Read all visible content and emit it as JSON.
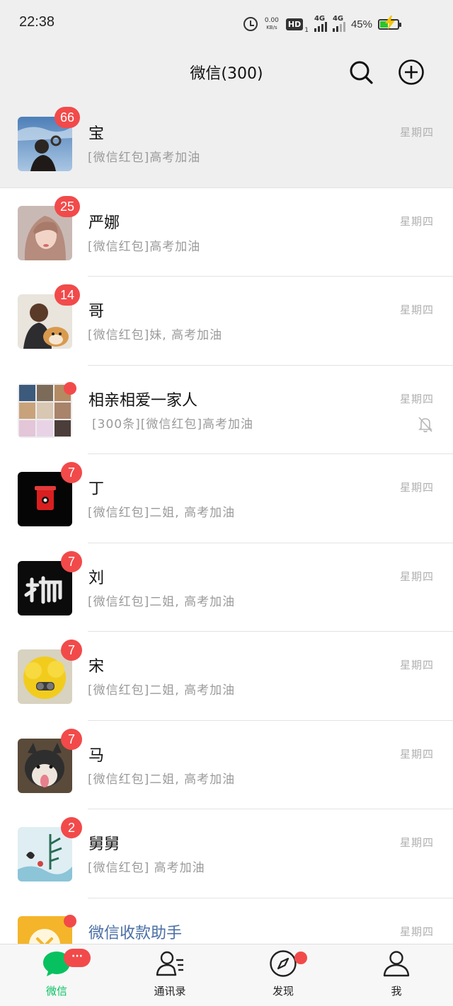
{
  "status_bar": {
    "time": "22:38",
    "net_speed_value": "0.00",
    "net_speed_unit": "KB/s",
    "hd_label": "HD",
    "hd_sub": "1",
    "sim1_net": "4G",
    "sim2_net": "4G",
    "battery_percent": "45%",
    "battery_level": 0.45
  },
  "header": {
    "title": "微信(300)"
  },
  "colors": {
    "badge": "#f24a4a",
    "active_tab": "#07c160",
    "bg_gray": "#efefef",
    "link_blue": "#4a6fa6"
  },
  "chats": [
    {
      "name": "宝",
      "preview": "[微信红包]高考加油",
      "time": "星期四",
      "badge": "66",
      "pinned": true,
      "avatar": "avatar-photo-person-sky"
    },
    {
      "name": "严娜",
      "preview": "[微信红包]高考加油",
      "time": "星期四",
      "badge": "25",
      "avatar": "avatar-photo-woman"
    },
    {
      "name": "哥",
      "preview": "[微信红包]妹, 高考加油",
      "time": "星期四",
      "badge": "14",
      "avatar": "avatar-photo-person-dog"
    },
    {
      "name": "相亲相爱一家人",
      "preview": "[300条][微信红包]高考加油",
      "time": "星期四",
      "dot": true,
      "muted": true,
      "avatar": "avatar-group-grid"
    },
    {
      "name": "丁",
      "preview": "[微信红包]二姐, 高考加油",
      "time": "星期四",
      "badge": "7",
      "avatar": "avatar-red-cup"
    },
    {
      "name": "刘",
      "preview": "[微信红包]二姐, 高考加油",
      "time": "星期四",
      "badge": "7",
      "avatar": "avatar-calligraphy"
    },
    {
      "name": "宋",
      "preview": "[微信红包]二姐, 高考加油",
      "time": "星期四",
      "badge": "7",
      "avatar": "avatar-yellow-fluffy"
    },
    {
      "name": "马",
      "preview": "[微信红包]二姐, 高考加油",
      "time": "星期四",
      "badge": "7",
      "avatar": "avatar-husky"
    },
    {
      "name": "舅舅",
      "preview": "[微信红包] 高考加油",
      "time": "星期四",
      "badge": "2",
      "avatar": "avatar-ink-painting"
    },
    {
      "name": "微信收款助手",
      "preview": "",
      "time": "星期四",
      "dot": true,
      "official": true,
      "avatar": "avatar-payment-assistant"
    }
  ],
  "tabs": [
    {
      "label": "微信",
      "icon": "chat-bubble-icon",
      "active": true,
      "badge_text": "···"
    },
    {
      "label": "通讯录",
      "icon": "contacts-icon"
    },
    {
      "label": "发现",
      "icon": "compass-icon",
      "dot": true
    },
    {
      "label": "我",
      "icon": "person-icon"
    }
  ]
}
